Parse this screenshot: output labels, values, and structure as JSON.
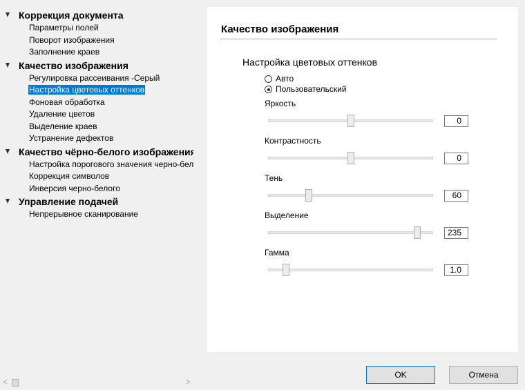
{
  "tree": {
    "groups": [
      {
        "label": "Коррекция документа",
        "items": [
          "Параметры полей",
          "Поворот изображения",
          "Заполнение краев"
        ]
      },
      {
        "label": "Качество изображения",
        "items": [
          "Регулировка рассеивания -Серый",
          "Настройка цветовых оттенков",
          "Фоновая обработка",
          "Удаление цветов",
          "Выделение краев",
          "Устранение дефектов"
        ]
      },
      {
        "label": "Качество чёрно-белого изображения",
        "items": [
          "Настройка порогового значения черно-белого",
          "Коррекция символов",
          "Инверсия черно-белого"
        ]
      },
      {
        "label": "Управление подачей",
        "items": [
          "Непрерывное сканирование"
        ]
      }
    ],
    "selected": "Настройка цветовых оттенков"
  },
  "scrollbar": {
    "left_arrow": "<",
    "right_arrow": ">"
  },
  "panel": {
    "title": "Качество изображения",
    "section": "Настройка цветовых оттенков",
    "radio_auto": "Авто",
    "radio_custom": "Пользовательский",
    "selected_radio": "custom",
    "sliders": [
      {
        "label": "Яркость",
        "value": "0",
        "level": 0.5
      },
      {
        "label": "Контрастность",
        "value": "0",
        "level": 0.5
      },
      {
        "label": "Тень",
        "value": "60",
        "level": 0.235
      },
      {
        "label": "Выделение",
        "value": "235",
        "level": 0.92
      },
      {
        "label": "Гамма",
        "value": "1.0",
        "level": 0.09
      }
    ]
  },
  "buttons": {
    "ok": "OK",
    "cancel": "Отмена"
  },
  "colors": {
    "selection": "#0078d7",
    "default_button_border": "#0078d7"
  }
}
